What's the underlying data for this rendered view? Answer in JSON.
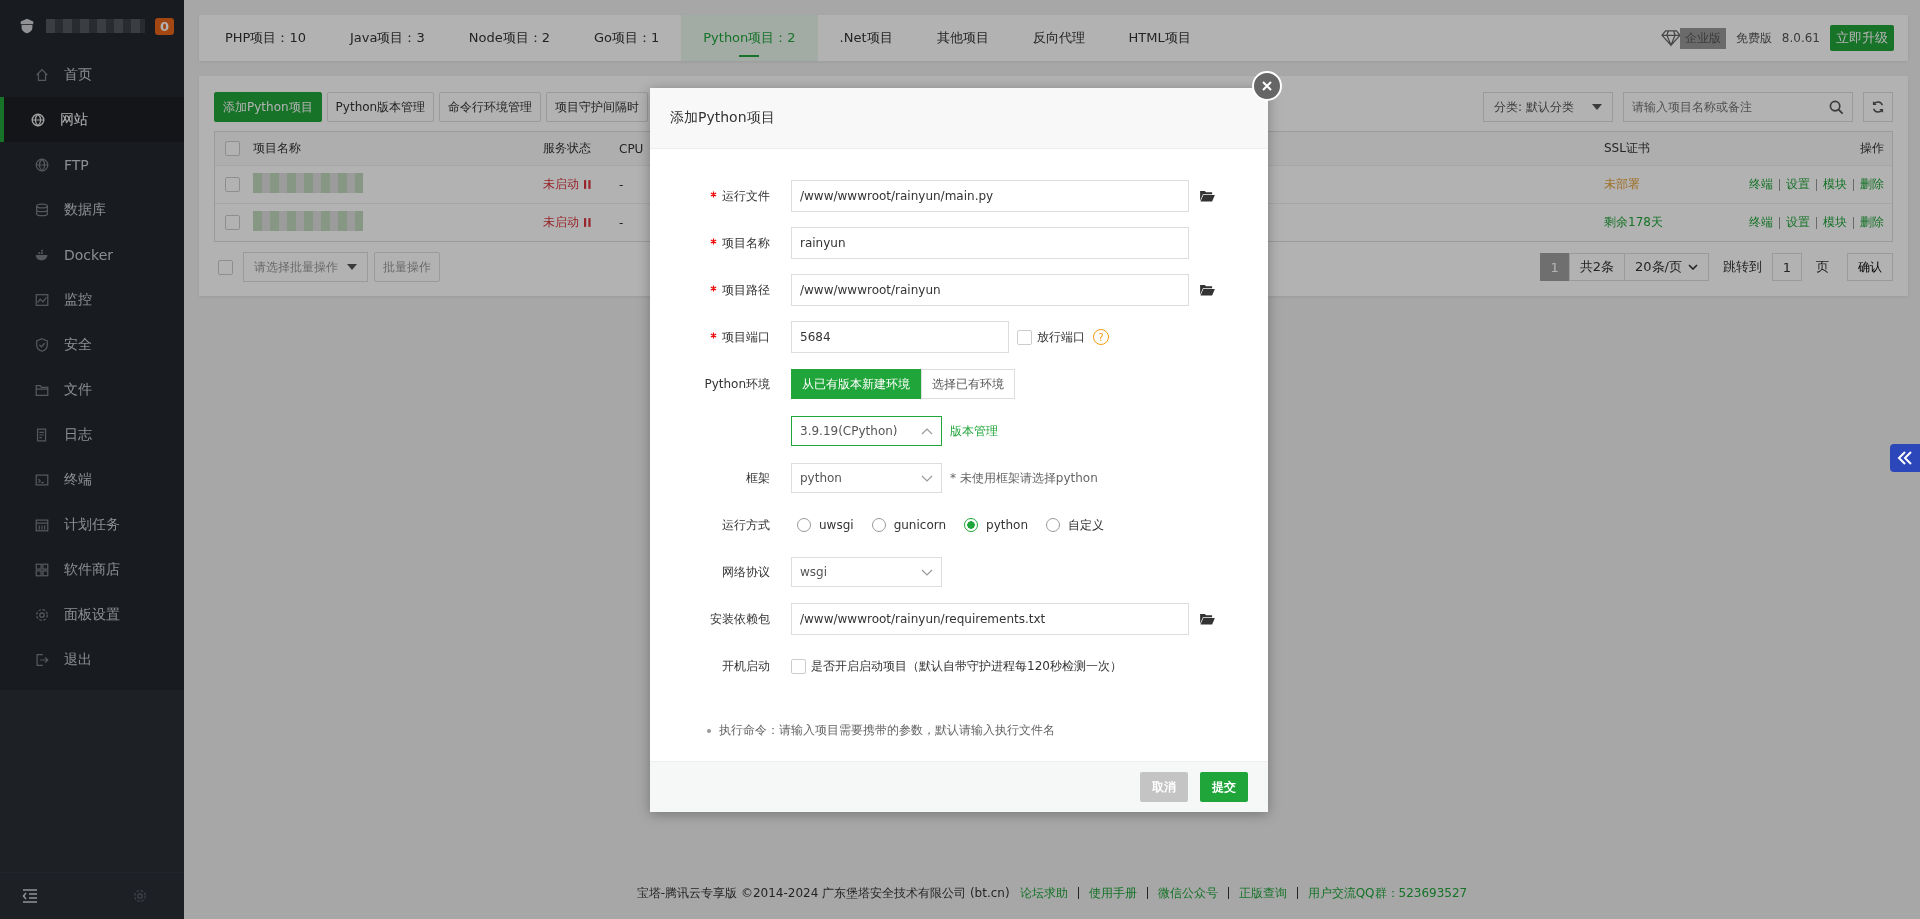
{
  "sidebar": {
    "badge": "0",
    "items": [
      {
        "label": "首页",
        "selected": false
      },
      {
        "label": "网站",
        "selected": true
      },
      {
        "label": "FTP",
        "selected": false
      },
      {
        "label": "数据库",
        "selected": false
      },
      {
        "label": "Docker",
        "selected": false
      },
      {
        "label": "监控",
        "selected": false
      },
      {
        "label": "安全",
        "selected": false
      },
      {
        "label": "文件",
        "selected": false
      },
      {
        "label": "日志",
        "selected": false
      },
      {
        "label": "终端",
        "selected": false
      },
      {
        "label": "计划任务",
        "selected": false
      },
      {
        "label": "软件商店",
        "selected": false
      },
      {
        "label": "面板设置",
        "selected": false
      },
      {
        "label": "退出",
        "selected": false
      }
    ]
  },
  "tabs": [
    {
      "label": "PHP项目：10",
      "selected": false
    },
    {
      "label": "Java项目：3",
      "selected": false
    },
    {
      "label": "Node项目：2",
      "selected": false
    },
    {
      "label": "Go项目：1",
      "selected": false
    },
    {
      "label": "Python项目：2",
      "selected": true
    },
    {
      "label": ".Net项目",
      "selected": false
    },
    {
      "label": "其他项目",
      "selected": false
    },
    {
      "label": "反向代理",
      "selected": false
    },
    {
      "label": "HTML项目",
      "selected": false
    }
  ],
  "edition": {
    "badge": "企业版",
    "plan": "免费版",
    "version": "8.0.61",
    "upgrade": "立即升级"
  },
  "toolbar": {
    "buttons": [
      {
        "label": "添加Python项目",
        "primary": true
      },
      {
        "label": "Python版本管理",
        "primary": false
      },
      {
        "label": "命令行环境管理",
        "primary": false
      },
      {
        "label": "项目守护间隔时",
        "primary": false
      }
    ],
    "category": "分类: 默认分类",
    "search_placeholder": "请输入项目名称或备注"
  },
  "table": {
    "columns": [
      "项目名称",
      "服务状态",
      "CPU",
      "SSL证书",
      "操作"
    ],
    "rows": [
      {
        "checked": false,
        "status": "未启动",
        "cpu": "-",
        "ssl": {
          "text": "未部署",
          "deployed": false
        },
        "actions": [
          "终端",
          "设置",
          "模块",
          "删除"
        ]
      },
      {
        "checked": false,
        "status": "未启动",
        "cpu": "-",
        "ssl": {
          "text": "剩余178天",
          "deployed": true
        },
        "actions": [
          "终端",
          "设置",
          "模块",
          "删除"
        ]
      }
    ],
    "all_checked": false
  },
  "bulk": {
    "checked": false,
    "placeholder": "请选择批量操作",
    "button": "批量操作"
  },
  "pagination": {
    "current": "1",
    "total": "共2条",
    "page_size": "20条/页",
    "goto_label": "跳转到",
    "goto_value": "1",
    "page_unit": "页",
    "confirm": "确认"
  },
  "dialog": {
    "title": "添加Python项目",
    "fields": [
      {
        "kind": "path",
        "label": "运行文件",
        "required": true,
        "value": "/www/wwwroot/rainyun/main.py"
      },
      {
        "kind": "text",
        "label": "项目名称",
        "required": true,
        "value": "rainyun"
      },
      {
        "kind": "path",
        "label": "项目路径",
        "required": true,
        "value": "/www/wwwroot/rainyun"
      },
      {
        "kind": "port",
        "label": "项目端口",
        "required": true,
        "value": "5684",
        "option": "放行端口",
        "checked": false,
        "help": "?"
      },
      {
        "kind": "segmented",
        "label": "Python环境",
        "required": false,
        "options": [
          {
            "label": "从已有版本新建环境",
            "selected": true
          },
          {
            "label": "选择已有环境",
            "selected": false
          }
        ]
      },
      {
        "kind": "select",
        "value": "3.9.19(CPython)",
        "expanded": true,
        "link": "版本管理"
      },
      {
        "kind": "select",
        "label": "框架",
        "required": false,
        "value": "python",
        "expanded": false,
        "hint": "* 未使用框架请选择python"
      },
      {
        "kind": "radio",
        "label": "运行方式",
        "required": false,
        "options": [
          {
            "label": "uwsgi",
            "selected": false
          },
          {
            "label": "gunicorn",
            "selected": false
          },
          {
            "label": "python",
            "selected": true
          },
          {
            "label": "自定义",
            "selected": false
          }
        ]
      },
      {
        "kind": "select",
        "label": "网络协议",
        "required": false,
        "value": "wsgi",
        "expanded": false
      },
      {
        "kind": "path",
        "label": "安装依赖包",
        "required": false,
        "value": "/www/wwwroot/rainyun/requirements.txt"
      },
      {
        "kind": "checkbox",
        "label": "开机启动",
        "required": false,
        "text": "是否开启启动项目（默认自带守护进程每120秒检测一次）",
        "checked": false
      }
    ],
    "note": "执行命令：请输入项目需要携带的参数，默认请输入执行文件名",
    "buttons": [
      {
        "label": "取消",
        "disabled": true
      },
      {
        "label": "提交",
        "disabled": false
      }
    ]
  },
  "footer": {
    "copyright": "宝塔-腾讯云专享版 ©2014-2024 广东堡塔安全技术有限公司 (bt.cn)",
    "links": [
      "论坛求助",
      "使用手册",
      "微信公众号",
      "正版查询",
      "用户交流QQ群：523693527"
    ]
  }
}
